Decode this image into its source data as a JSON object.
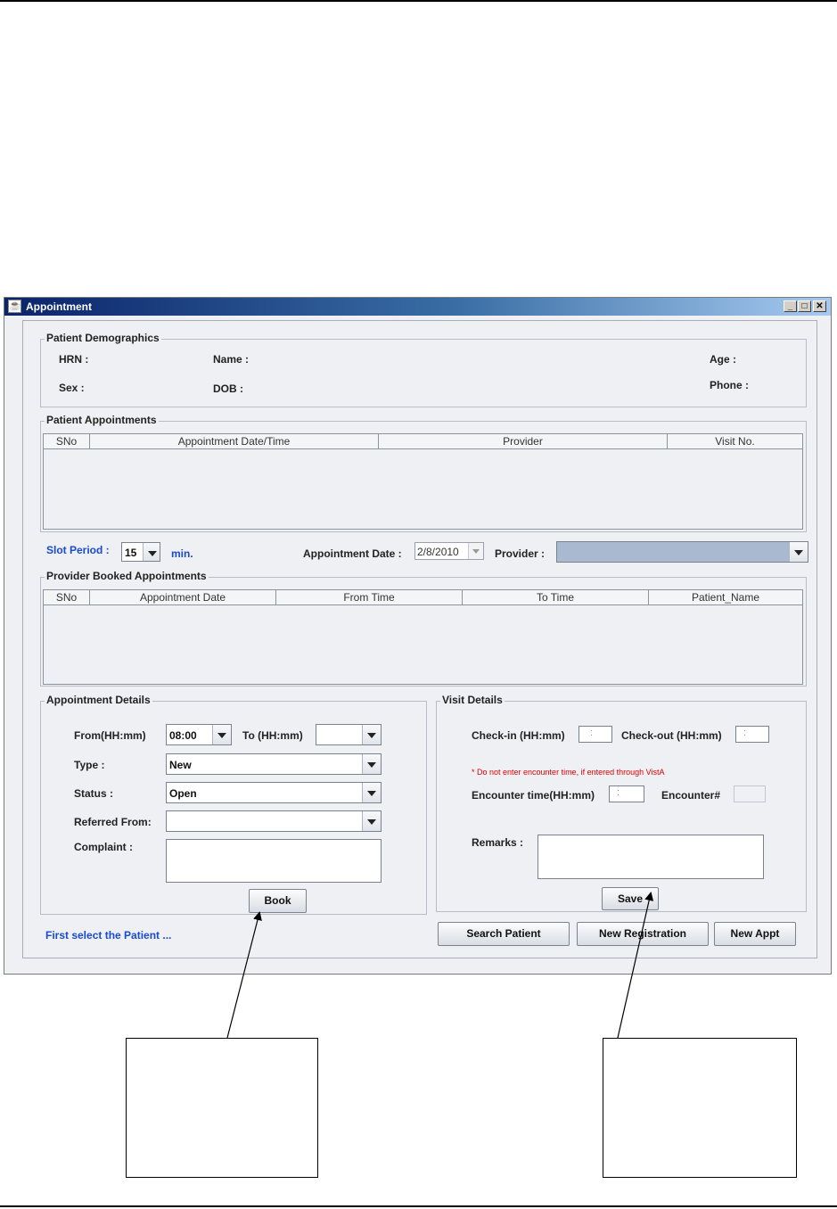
{
  "window": {
    "title": "Appointment",
    "min_icon": "minimize-icon",
    "max_icon": "maximize-icon",
    "close_icon": "close-icon"
  },
  "demographics": {
    "group_label": "Patient Demographics",
    "hrn_label": "HRN :",
    "name_label": "Name :",
    "age_label": "Age :",
    "sex_label": "Sex :",
    "dob_label": "DOB :",
    "phone_label": "Phone :"
  },
  "patient_appointments": {
    "group_label": "Patient Appointments",
    "columns": [
      "SNo",
      "Appointment Date/Time",
      "Provider",
      "Visit No."
    ]
  },
  "slot": {
    "label": "Slot Period :",
    "value": "15",
    "unit": "min."
  },
  "appointment_date": {
    "label": "Appointment Date :",
    "value": "2/8/2010"
  },
  "provider": {
    "label": "Provider :",
    "value": ""
  },
  "provider_booked": {
    "group_label": "Provider Booked Appointments",
    "columns": [
      "SNo",
      "Appointment Date",
      "From Time",
      "To Time",
      "Patient_Name"
    ]
  },
  "appointment_details": {
    "group_label": "Appointment Details",
    "from_label": "From(HH:mm)",
    "from_value": "08:00",
    "to_label": "To (HH:mm)",
    "to_value": "",
    "type_label": "Type :",
    "type_value": "New",
    "status_label": "Status :",
    "status_value": "Open",
    "referred_label": "Referred From:",
    "referred_value": "",
    "complaint_label": "Complaint :",
    "book_label": "Book"
  },
  "visit_details": {
    "group_label": "Visit Details",
    "checkin_label": "Check-in (HH:mm)",
    "checkin_value": ":",
    "checkout_label": "Check-out (HH:mm)",
    "checkout_value": ":",
    "warning": "* Do not enter encounter time, if entered through VistA",
    "encounter_time_label": "Encounter time(HH:mm)",
    "encounter_time_value": ":",
    "encounter_no_label": "Encounter#",
    "remarks_label": "Remarks :",
    "save_label": "Save"
  },
  "footer": {
    "status_text": "First select the Patient ...",
    "search_label": "Search Patient",
    "new_registration_label": "New Registration",
    "new_appt_label": "New Appt"
  },
  "colors": {
    "title_bar_start": "#0a246a",
    "title_bar_end": "#a6caf0",
    "label_blue": "#1a4ad0",
    "warning_red": "#e00000",
    "provider_fill": "#a9b9cf"
  }
}
